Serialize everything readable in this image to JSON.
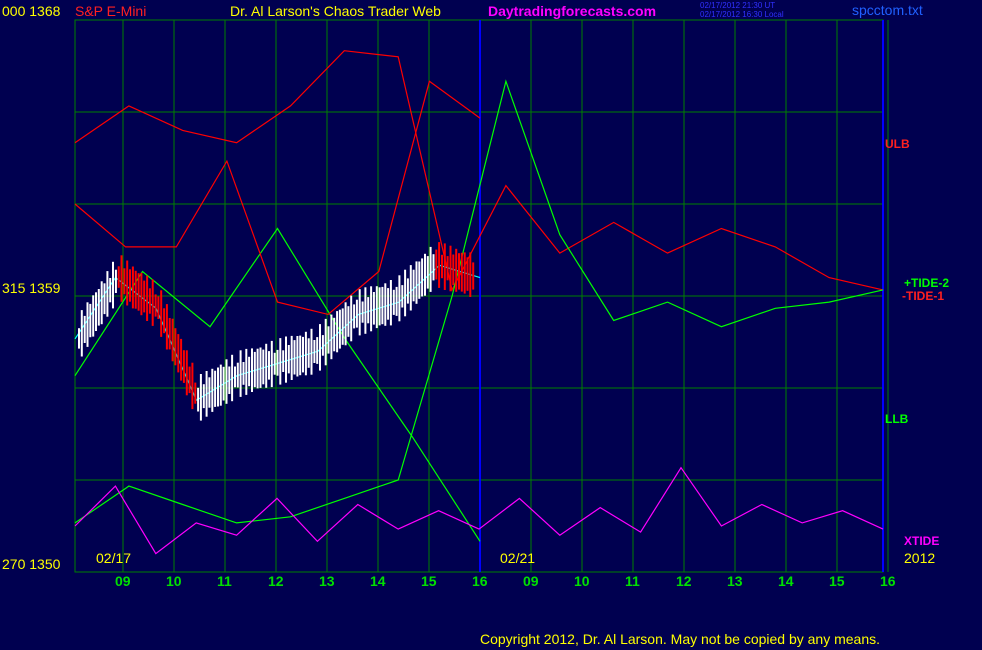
{
  "header": {
    "y_top_label": "000  1368",
    "instrument": "S&P E-Mini",
    "title": "Dr. Al Larson's Chaos Trader Web",
    "site": "Daytradingforecasts.com",
    "timestamp_ut": "02/17/2012 21:30 UT",
    "timestamp_local": "02/17/2012 16:30 Local",
    "filename": "spcctom.txt"
  },
  "y_labels": {
    "mid": "315  1359",
    "bottom": "270  1350"
  },
  "x_axis": {
    "hours_day1": [
      "09",
      "10",
      "11",
      "12",
      "13",
      "14",
      "15",
      "16"
    ],
    "hours_day2": [
      "09",
      "10",
      "11",
      "12",
      "13",
      "14",
      "15",
      "16"
    ],
    "date1": "02/17",
    "date2": "02/21",
    "year": "2012"
  },
  "right_labels": {
    "ulb": "ULB",
    "tide2": "+TIDE-2",
    "tide1": "-TIDE-1",
    "llb": "LLB",
    "xtide": "XTIDE"
  },
  "footer": {
    "copyright": "Copyright 2012, Dr. Al Larson. May not be copied by any means."
  },
  "colors": {
    "background": "#000050",
    "grid": "#008000",
    "divider": "#0000ff",
    "ulb": "#ff0000",
    "llb": "#00ff00",
    "price_up": "#ffffff",
    "price_down": "#ff0000",
    "moving_average": "#00ffff",
    "xtide": "#ff00ff"
  },
  "chart_data": {
    "type": "line",
    "ylim": [
      1350,
      1368
    ],
    "y_ticks": [
      1350,
      1359,
      1368
    ],
    "series": [
      {
        "name": "ULB",
        "values": [
          1364.0,
          1365.2,
          1364.4,
          1364.0,
          1365.2,
          1367.0,
          1366.8,
          1359.2,
          1362.6,
          1360.4,
          1361.4,
          1360.4,
          1361.2,
          1360.6,
          1359.6,
          1359.2
        ]
      },
      {
        "name": "LLB",
        "values": [
          1351.6,
          1352.8,
          1352.2,
          1351.6,
          1351.8,
          1352.4,
          1353.0,
          1359.0,
          1366.0,
          1361.0,
          1358.2,
          1358.8,
          1358.0,
          1358.6,
          1358.8,
          1359.2
        ]
      },
      {
        "name": "+TIDE-2",
        "values": [
          1356.4,
          1359.8,
          1358.0,
          1361.2,
          1357.6,
          1354.4,
          1351.0
        ]
      },
      {
        "name": "-TIDE-1",
        "values": [
          1362.0,
          1360.6,
          1360.6,
          1363.4,
          1358.8,
          1358.4,
          1359.8,
          1366.0,
          1364.8
        ]
      },
      {
        "name": "XTIDE",
        "values": [
          1351.5,
          1352.8,
          1350.6,
          1351.6,
          1351.2,
          1352.4,
          1351.0,
          1352.2,
          1351.4,
          1352.0,
          1351.4,
          1352.4,
          1351.2,
          1352.1,
          1351.3,
          1353.4,
          1351.5,
          1352.2,
          1351.6,
          1352.0,
          1351.4
        ]
      },
      {
        "name": "Price",
        "values": [
          1357.6,
          1359.6,
          1358.6,
          1355.6,
          1356.4,
          1356.8,
          1357.2,
          1358.4,
          1358.8,
          1360.0,
          1359.6
        ]
      }
    ]
  }
}
